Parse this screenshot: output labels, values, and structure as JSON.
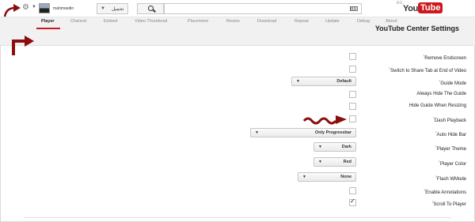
{
  "topbar": {
    "username": "mahmoedin",
    "language_label": "تحميل",
    "search_placeholder": "",
    "logo_prefix": "EG",
    "logo_you": "You",
    "logo_tube": "Tube"
  },
  "settings": {
    "title": "YouTube Center Settings",
    "tabs": [
      {
        "label": "Player",
        "active": true
      },
      {
        "label": "Channel",
        "active": false
      },
      {
        "label": "Embed",
        "active": false
      },
      {
        "label": "Video Thumbnail",
        "active": false
      },
      {
        "label": "Placement",
        "active": false
      },
      {
        "label": "Resize",
        "active": false
      },
      {
        "label": "Download",
        "active": false
      },
      {
        "label": "Repeat",
        "active": false
      },
      {
        "label": "Update",
        "active": false
      },
      {
        "label": "Debug",
        "active": false
      },
      {
        "label": "About",
        "active": false
      }
    ]
  },
  "options": [
    {
      "label": "Remove Endscreen",
      "help": "?",
      "control": "checkbox",
      "checked": false
    },
    {
      "label": "Switch to Share Tab at End of Video",
      "help": "?",
      "control": "checkbox",
      "checked": false
    },
    {
      "label": "Guide Mode",
      "help": "?",
      "control": "select",
      "value": "Default"
    },
    {
      "label": "Always Hide The Guide",
      "help": "",
      "control": "checkbox",
      "checked": false
    },
    {
      "label": "Hide Guide When Resizing",
      "help": "",
      "control": "checkbox",
      "checked": false
    },
    {
      "label": "Dash Playback",
      "help": "?",
      "control": "checkbox",
      "checked": false
    },
    {
      "label": "Auto Hide Bar",
      "help": "?",
      "control": "select",
      "value": "Only Progressbar"
    },
    {
      "label": "Player Theme",
      "help": "?",
      "control": "select",
      "value": "Dark"
    },
    {
      "label": "Player Color",
      "help": "?",
      "control": "select",
      "value": "Red"
    },
    {
      "label": "Flash WMode",
      "help": "?",
      "control": "select",
      "value": "None"
    },
    {
      "label": "Enable Annotations",
      "help": "?",
      "control": "checkbox",
      "checked": false
    },
    {
      "label": "Scroll To Player",
      "help": "?",
      "control": "checkbox",
      "checked": true
    }
  ],
  "colors": {
    "accent": "#cc181e",
    "annotation_arrow": "#8b0d0d"
  }
}
